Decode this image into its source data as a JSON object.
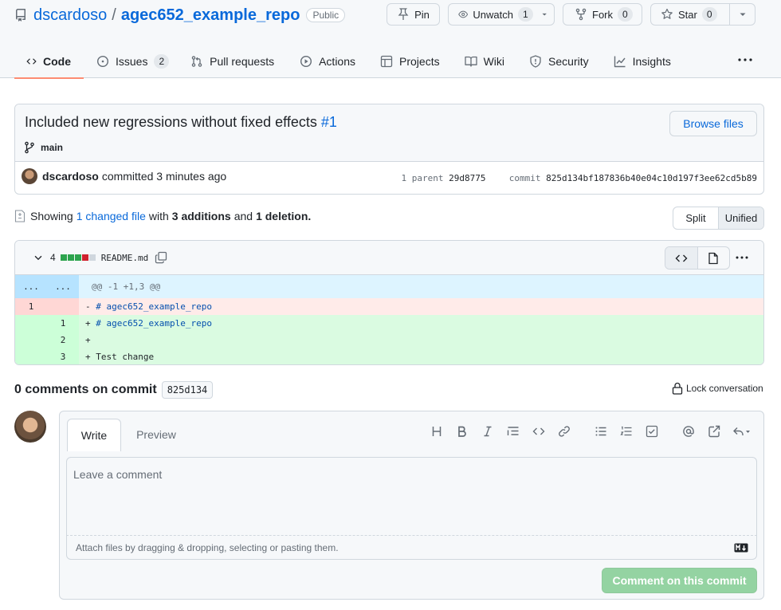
{
  "repo": {
    "owner": "dscardoso",
    "separator": "/",
    "name": "agec652_example_repo",
    "visibility": "Public"
  },
  "actions": {
    "pin": "Pin",
    "unwatch": "Unwatch",
    "watch_count": "1",
    "fork": "Fork",
    "fork_count": "0",
    "star": "Star",
    "star_count": "0"
  },
  "tabs": [
    {
      "label": "Code",
      "icon": "code-icon"
    },
    {
      "label": "Issues",
      "count": "2",
      "icon": "issue-opened-icon"
    },
    {
      "label": "Pull requests",
      "icon": "git-pull-request-icon"
    },
    {
      "label": "Actions",
      "icon": "play-icon"
    },
    {
      "label": "Projects",
      "icon": "table-icon"
    },
    {
      "label": "Wiki",
      "icon": "book-icon"
    },
    {
      "label": "Security",
      "icon": "shield-icon"
    },
    {
      "label": "Insights",
      "icon": "graph-icon"
    }
  ],
  "commit": {
    "title": "Included new regressions without fixed effects",
    "pr_ref": "#1",
    "branch": "main",
    "browse_label": "Browse files",
    "author": "dscardoso",
    "when": "committed 3 minutes ago",
    "parent_label": "1 parent",
    "parent_sha": "29d8775",
    "commit_label": "commit",
    "sha": "825d134bf187836b40e04c10d197f3ee62cd5b89"
  },
  "summary": {
    "showing": "Showing",
    "changed": "1 changed file",
    "with": "with",
    "additions": "3 additions",
    "and": "and",
    "deletions": "1 deletion."
  },
  "view_toggle": {
    "split": "Split",
    "unified": "Unified"
  },
  "diff": {
    "count": "4",
    "file": "README.md",
    "hunk_l": "...",
    "hunk_r": "...",
    "hunk": "@@ -1 +1,3 @@",
    "lines": [
      {
        "type": "del",
        "old": "1",
        "new": "",
        "prefix": "-",
        "text": "# agec652_example_repo"
      },
      {
        "type": "add",
        "old": "",
        "new": "1",
        "prefix": "+",
        "text": "# agec652_example_repo"
      },
      {
        "type": "add",
        "old": "",
        "new": "2",
        "prefix": "+",
        "text": ""
      },
      {
        "type": "add",
        "old": "",
        "new": "3",
        "prefix": "+",
        "text": "Test change"
      }
    ]
  },
  "comments": {
    "title": "0 comments on commit",
    "sha": "825d134",
    "lock": "Lock conversation",
    "write": "Write",
    "preview": "Preview",
    "placeholder": "Leave a comment",
    "attach": "Attach files by dragging & dropping, selecting or pasting them.",
    "md": "MD",
    "submit": "Comment on this commit"
  },
  "colors": {
    "link": "#0969da",
    "active_tab": "#fd8c73",
    "add_block": "#2da44e",
    "del_block": "#cf222e",
    "submit": "#94d3a2"
  }
}
